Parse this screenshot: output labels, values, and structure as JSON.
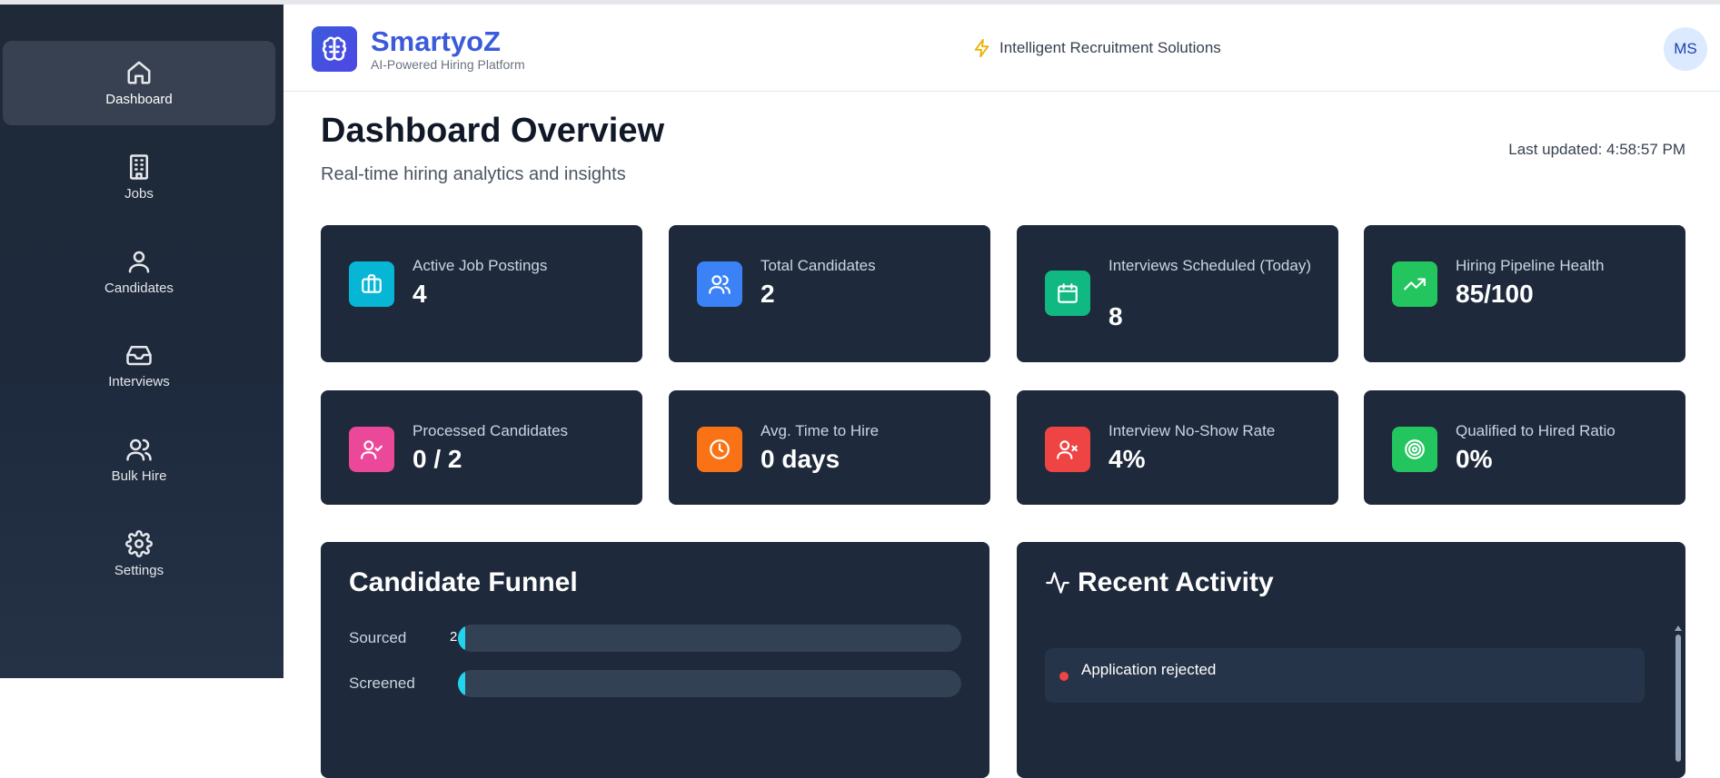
{
  "sidebar": {
    "items": [
      {
        "label": "Dashboard",
        "icon": "home-icon",
        "active": true
      },
      {
        "label": "Jobs",
        "icon": "building-icon"
      },
      {
        "label": "Candidates",
        "icon": "user-icon"
      },
      {
        "label": "Interviews",
        "icon": "inbox-icon"
      },
      {
        "label": "Bulk Hire",
        "icon": "users-icon"
      },
      {
        "label": "Settings",
        "icon": "gear-icon"
      }
    ]
  },
  "header": {
    "brand_name": "SmartyoZ",
    "brand_subtitle": "AI-Powered Hiring Platform",
    "tagline": "Intelligent Recruitment Solutions",
    "avatar_initials": "MS"
  },
  "main": {
    "title": "Dashboard Overview",
    "subtitle": "Real-time hiring analytics and insights",
    "last_updated": "Last updated: 4:58:57 PM"
  },
  "stats": [
    {
      "label": "Active Job Postings",
      "value": "4",
      "icon": "briefcase-icon",
      "color": "#06b6d4"
    },
    {
      "label": "Total Candidates",
      "value": "2",
      "icon": "users-icon",
      "color": "#3b82f6"
    },
    {
      "label": "Interviews Scheduled (Today)",
      "value": "8",
      "icon": "calendar-icon",
      "color": "#10b981"
    },
    {
      "label": "Hiring Pipeline Health",
      "value": "85/100",
      "icon": "trending-up-icon",
      "color": "#22c55e"
    },
    {
      "label": "Processed Candidates",
      "value": "0 / 2",
      "icon": "user-check-icon",
      "color": "#ec4899"
    },
    {
      "label": "Avg. Time to Hire",
      "value": "0 days",
      "icon": "clock-icon",
      "color": "#f97316"
    },
    {
      "label": "Interview No-Show Rate",
      "value": "4%",
      "icon": "user-x-icon",
      "color": "#ef4444"
    },
    {
      "label": "Qualified to Hired Ratio",
      "value": "0%",
      "icon": "target-icon",
      "color": "#22c55e"
    }
  ],
  "funnel": {
    "title": "Candidate Funnel",
    "rows": [
      {
        "label": "Sourced",
        "count": "2",
        "fraction": 0.0
      },
      {
        "label": "Screened",
        "count": "",
        "fraction": 0.0
      }
    ],
    "fill_color": "#22d3ee"
  },
  "activity": {
    "title": "Recent Activity",
    "items": [
      {
        "text": "Application rejected",
        "status_color": "#ef4444"
      }
    ]
  }
}
